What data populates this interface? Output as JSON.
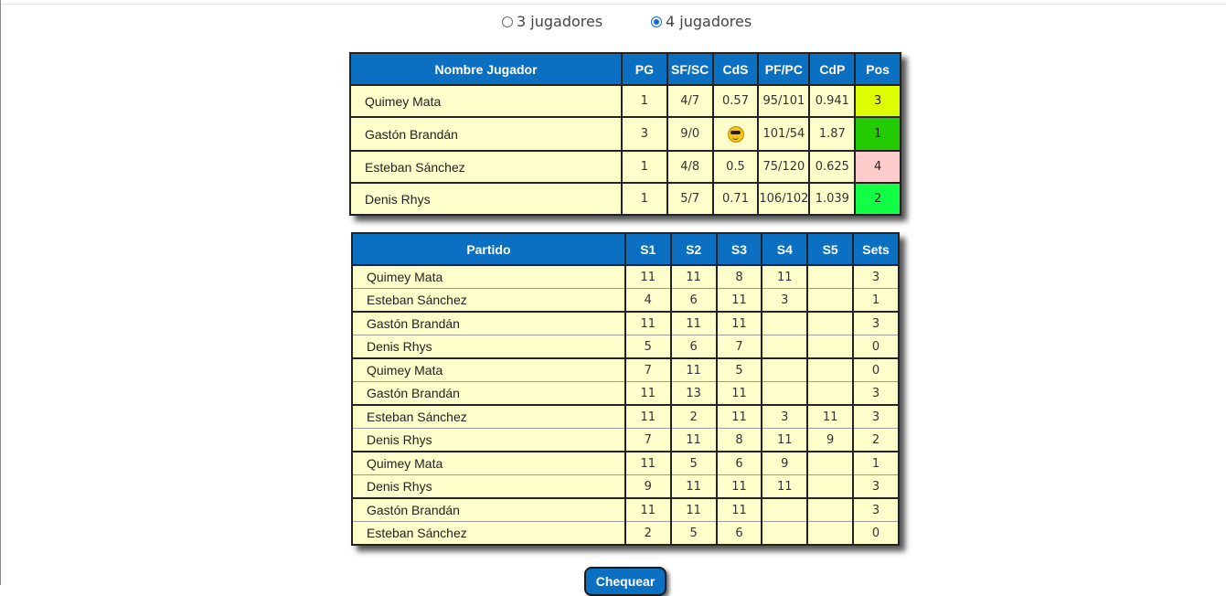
{
  "radio": {
    "options": [
      {
        "label": "3 jugadores",
        "checked": false
      },
      {
        "label": "4 jugadores",
        "checked": true
      }
    ]
  },
  "standings": {
    "headers": [
      "Nombre Jugador",
      "PG",
      "SF/SC",
      "CdS",
      "PF/PC",
      "CdP",
      "Pos"
    ],
    "rows": [
      {
        "name": "Quimey Mata",
        "pg": "1",
        "sfsc": "4/7",
        "cds": "0.57",
        "pfpc": "95/101",
        "cdp": "0.941",
        "pos": "3",
        "pos_color": "#ddff00"
      },
      {
        "name": "Gastón Brandán",
        "pg": "3",
        "sfsc": "9/0",
        "cds": "sunglasses-emoji",
        "pfpc": "101/54",
        "cdp": "1.87",
        "pos": "1",
        "pos_color": "#22cc00"
      },
      {
        "name": "Esteban Sánchez",
        "pg": "1",
        "sfsc": "4/8",
        "cds": "0.5",
        "pfpc": "75/120",
        "cdp": "0.625",
        "pos": "4",
        "pos_color": "#ffcccc"
      },
      {
        "name": "Denis Rhys",
        "pg": "1",
        "sfsc": "5/7",
        "cds": "0.71",
        "pfpc": "106/102",
        "cdp": "1.039",
        "pos": "2",
        "pos_color": "#11ff44"
      }
    ]
  },
  "matches": {
    "headers": [
      "Partido",
      "S1",
      "S2",
      "S3",
      "S4",
      "S5",
      "Sets"
    ],
    "rows": [
      {
        "name": "Quimey Mata",
        "s1": "11",
        "s2": "11",
        "s3": "8",
        "s4": "11",
        "s5": "",
        "sets": "3"
      },
      {
        "name": "Esteban Sánchez",
        "s1": "4",
        "s2": "6",
        "s3": "11",
        "s4": "3",
        "s5": "",
        "sets": "1"
      },
      {
        "name": "Gastón Brandán",
        "s1": "11",
        "s2": "11",
        "s3": "11",
        "s4": "",
        "s5": "",
        "sets": "3"
      },
      {
        "name": "Denis Rhys",
        "s1": "5",
        "s2": "6",
        "s3": "7",
        "s4": "",
        "s5": "",
        "sets": "0"
      },
      {
        "name": "Quimey Mata",
        "s1": "7",
        "s2": "11",
        "s3": "5",
        "s4": "",
        "s5": "",
        "sets": "0"
      },
      {
        "name": "Gastón Brandán",
        "s1": "11",
        "s2": "13",
        "s3": "11",
        "s4": "",
        "s5": "",
        "sets": "3"
      },
      {
        "name": "Esteban Sánchez",
        "s1": "11",
        "s2": "2",
        "s3": "11",
        "s4": "3",
        "s5": "11",
        "sets": "3"
      },
      {
        "name": "Denis Rhys",
        "s1": "7",
        "s2": "11",
        "s3": "8",
        "s4": "11",
        "s5": "9",
        "sets": "2"
      },
      {
        "name": "Quimey Mata",
        "s1": "11",
        "s2": "5",
        "s3": "6",
        "s4": "9",
        "s5": "",
        "sets": "1"
      },
      {
        "name": "Denis Rhys",
        "s1": "9",
        "s2": "11",
        "s3": "11",
        "s4": "11",
        "s5": "",
        "sets": "3"
      },
      {
        "name": "Gastón Brandán",
        "s1": "11",
        "s2": "11",
        "s3": "11",
        "s4": "",
        "s5": "",
        "sets": "3"
      },
      {
        "name": "Esteban Sánchez",
        "s1": "2",
        "s2": "5",
        "s3": "6",
        "s4": "",
        "s5": "",
        "sets": "0"
      }
    ]
  },
  "button": {
    "label": "Chequear"
  }
}
